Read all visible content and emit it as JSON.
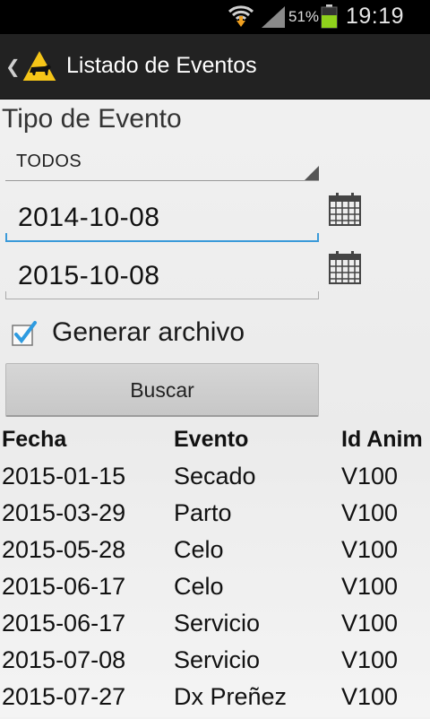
{
  "status_bar": {
    "battery_percent": "51%",
    "time": "19:19",
    "icons": [
      "wifi-icon",
      "download-arrow-icon",
      "signal-icon",
      "battery-icon"
    ],
    "battery_color": "#8fd11c"
  },
  "action_bar": {
    "title": "Listado de Eventos",
    "back_icon": "chevron-left-icon",
    "logo_icon": "cow-warning-sign-icon",
    "logo_color": "#f5c518"
  },
  "form": {
    "tipo_label": "Tipo de Evento",
    "tipo_value": "TODOS",
    "date_from": "2014-10-08",
    "date_to": "2015-10-08",
    "calendar_icon": "calendar-icon",
    "generar_label": "Generar archivo",
    "generar_checked": true,
    "buscar_label": "Buscar",
    "accent_color": "#3a9ad9"
  },
  "table": {
    "headers": [
      "Fecha",
      "Evento",
      "Id Anim"
    ],
    "rows": [
      [
        "2015-01-15",
        "Secado",
        "V100"
      ],
      [
        "2015-03-29",
        "Parto",
        "V100"
      ],
      [
        "2015-05-28",
        "Celo",
        "V100"
      ],
      [
        "2015-06-17",
        "Celo",
        "V100"
      ],
      [
        "2015-06-17",
        "Servicio",
        "V100"
      ],
      [
        "2015-07-08",
        "Servicio",
        "V100"
      ],
      [
        "2015-07-27",
        "Dx Preñez",
        "V100"
      ]
    ]
  }
}
